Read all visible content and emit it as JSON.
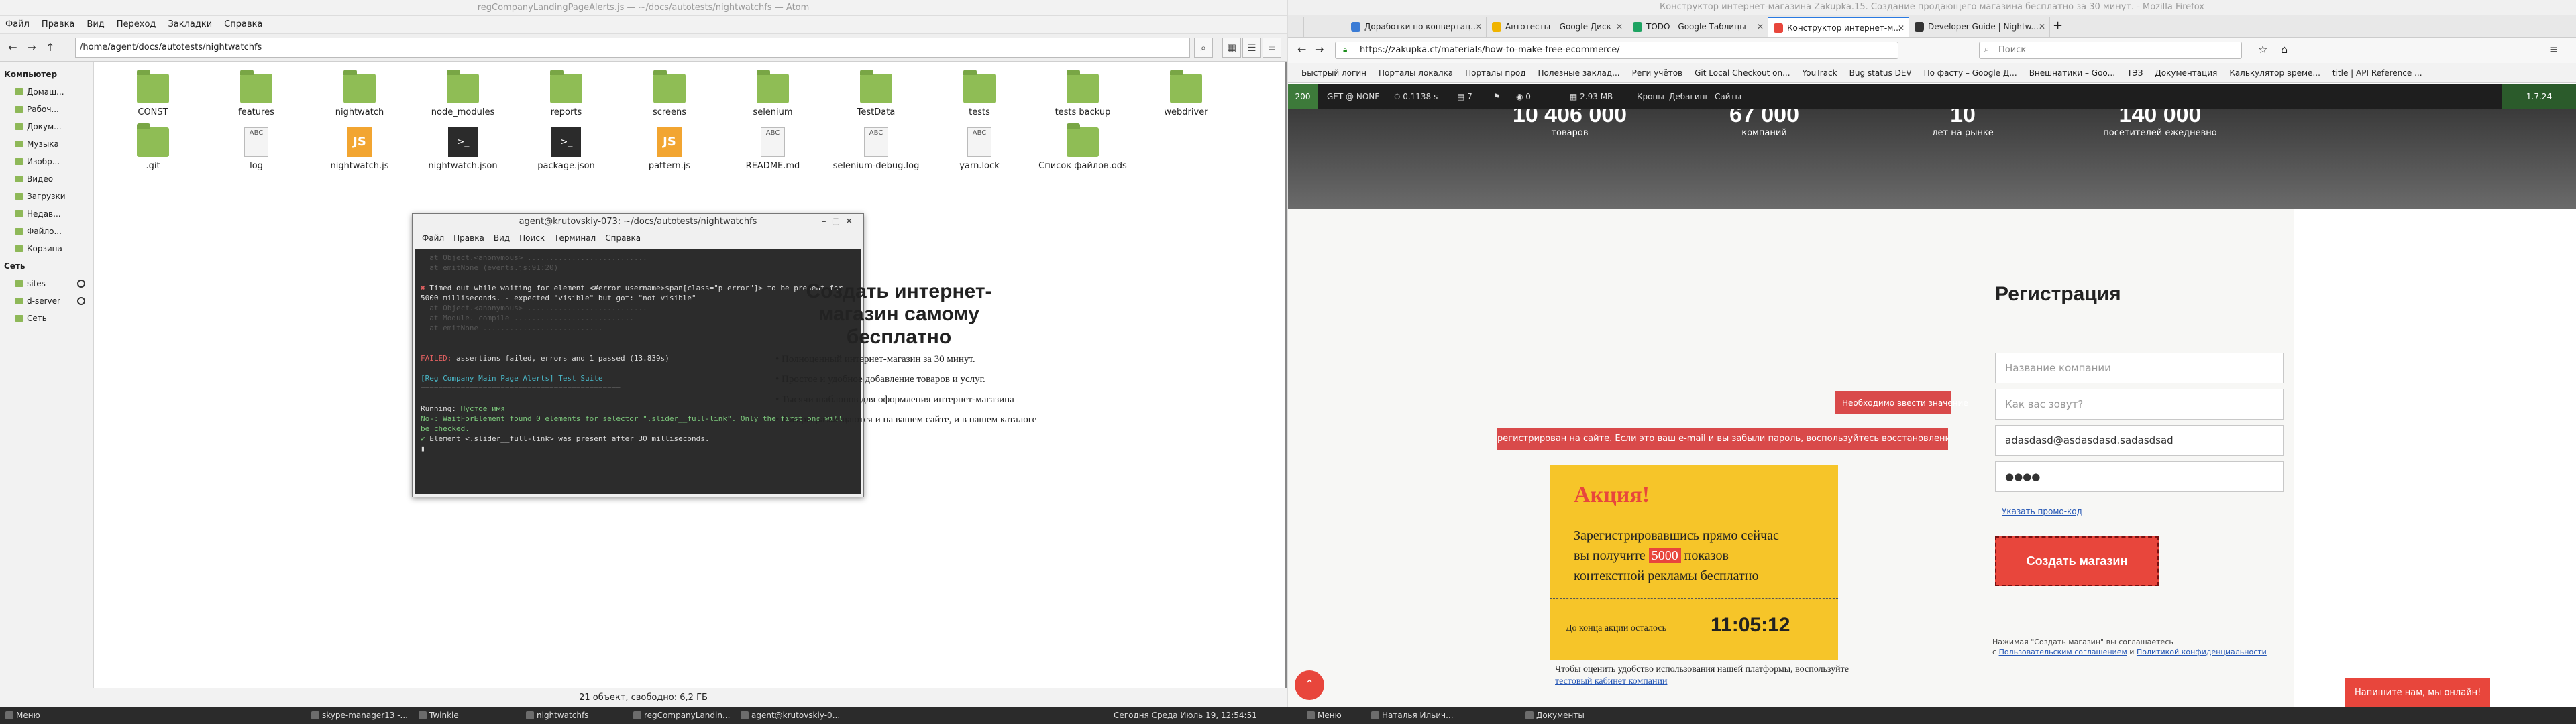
{
  "file_manager": {
    "title": "regCompanyLandingPageAlerts.js — ~/docs/autotests/nightwatchfs — Atom",
    "menu": [
      "Файл",
      "Правка",
      "Вид",
      "Переход",
      "Закладки",
      "Справка"
    ],
    "path": "/home/agent/docs/autotests/nightwatchfs",
    "sidebar": {
      "computer_header": "Компьютер",
      "computer_items": [
        "Домаш...",
        "Рабоч...",
        "Докум...",
        "Музыка",
        "Изобр...",
        "Видео",
        "Загрузки",
        "Недав...",
        "Файло...",
        "Корзина"
      ],
      "network_header": "Сеть",
      "network_items": [
        "sites",
        "d-server",
        "Сеть"
      ]
    },
    "files": [
      {
        "name": "CONST",
        "type": "folder"
      },
      {
        "name": "features",
        "type": "folder"
      },
      {
        "name": "nightwatch",
        "type": "folder"
      },
      {
        "name": "node_modules",
        "type": "folder"
      },
      {
        "name": "reports",
        "type": "folder"
      },
      {
        "name": "screens",
        "type": "folder"
      },
      {
        "name": "selenium",
        "type": "folder"
      },
      {
        "name": "TestData",
        "type": "folder"
      },
      {
        "name": "tests",
        "type": "folder"
      },
      {
        "name": "tests backup",
        "type": "folder"
      },
      {
        "name": "webdriver",
        "type": "folder"
      },
      {
        "name": ".git",
        "type": "folder"
      },
      {
        "name": "log",
        "type": "doc"
      },
      {
        "name": "nightwatch.js",
        "type": "js"
      },
      {
        "name": "nightwatch.json",
        "type": "term"
      },
      {
        "name": "package.json",
        "type": "term"
      },
      {
        "name": "pattern.js",
        "type": "js"
      },
      {
        "name": "README.md",
        "type": "doc"
      },
      {
        "name": "selenium-debug.log",
        "type": "doc"
      },
      {
        "name": "yarn.lock",
        "type": "doc"
      },
      {
        "name": "Список файлов.ods",
        "type": "folder"
      }
    ],
    "status": "21 объект, свободно: 6,2 ГБ"
  },
  "terminal": {
    "title": "agent@krutovskiy-073: ~/docs/autotests/nightwatchfs",
    "menu": [
      "Файл",
      "Правка",
      "Вид",
      "Поиск",
      "Терминал",
      "Справка"
    ],
    "lines": {
      "timeout": "Timed out while waiting for element <#error_username>span[class=\"p_error\"]> to be present for 5000 milliseconds.  - expected \"visible\" but got: \"not visible\"",
      "summary_fail": "FAILED:",
      "summary": "assertions failed,   errors and 1 passed (13.839s)",
      "suite": "[Reg Company Main Page Alerts] Test Suite",
      "running": "Running:",
      "running_name": "Пустое имя",
      "wait": "  No-: WaitForElement found 0 elements for selector \".slider__full-link\". Only the first one will be checked.",
      "present": "  Element <.slider__full-link> was present after 30 milliseconds."
    }
  },
  "browser": {
    "title": "Конструктор интернет-магазина Zakupka.15. Создание продающего магазина бесплатно за 30 минут. - Mozilla Firefox",
    "tabs": [
      "Доработки по конвертац...",
      "Автотесты – Google Диск",
      "TODO - Google Таблицы",
      "Конструктор интернет-м...",
      "Developer Guide | Nightw..."
    ],
    "url": "https://zakupka.ct/materials/how-to-make-free-ecommerce/",
    "search_placeholder": "Поиск",
    "bookmarks": [
      "Быстрый логин",
      "Порталы локалка",
      "Порталы прод",
      "Полезные заклад...",
      "Реги учётов",
      "Git Local Checkout on...",
      "YouTrack",
      "Bug status DEV",
      "По фасту – Google Д...",
      "Внешнатики – Goo...",
      "ТЭЗ",
      "Документация",
      "Калькулятор време...",
      "title | API Reference ..."
    ],
    "debug": {
      "code": "200",
      "method": "GET @ NONE",
      "time": "0.1138 s",
      "queries": "7",
      "mem": "2.93 MB",
      "items": [
        "Кроны",
        "Дебагинг",
        "Сайты"
      ],
      "version": "1.7.24"
    },
    "stats": [
      {
        "n": "10 406 000",
        "l": "товаров"
      },
      {
        "n": "67 000",
        "l": "компаний"
      },
      {
        "n": "10",
        "l": "лет на рынке"
      },
      {
        "n": "140 000",
        "l": "посетителей ежедневно"
      }
    ],
    "heading": "Создать интернет-магазин самому бесплатно",
    "features": [
      "• Полноценный интернет-магазин за 30 минут.",
      "• Простое и удобное добавление товаров и услуг.",
      "• Тысячи шаблонов для оформления интернет-магазина",
      "• Товары размещаются и на вашем сайте, и в нашем каталоге"
    ],
    "promo": {
      "title": "Акция!",
      "text1": "Зарегистрировавшись прямо сейчас",
      "text2a": "вы получите ",
      "badge": "5000",
      "text2b": " показов",
      "text3": "контекстной рекламы бесплатно",
      "countdown_label": "До конца акции осталось",
      "countdown": "11:05:12"
    },
    "below_promo": "Чтобы оценить удобство использования нашей платформы, воспользуйте",
    "below_promo_link": "тестовый кабинет компании",
    "registration": {
      "title": "Регистрация",
      "company_placeholder": "Название компании",
      "name_placeholder": "Как вас зовут?",
      "email_value": "adasdasd@asdasdasd.sadasdsad",
      "password_value": "●●●●",
      "error_tip": "Необходимо ввести значение",
      "error_bar": "регистрирован на сайте. Если это ваш e-mail и вы забыли пароль, воспользуйтесь",
      "error_bar_link": "восстановлением пароля.",
      "promo_link": "Указать промо-код",
      "button": "Создать магазин",
      "terms1": "Нажимая \"Создать магазин\" вы соглашаетесь",
      "terms2": "с",
      "terms_link1": "Пользовательским соглашением",
      "terms_and": "и",
      "terms_link2": "Политикой конфиденциальности"
    },
    "chat": "Напишите нам, мы онлайн!"
  },
  "taskbar": {
    "menu": "Меню",
    "tasks": [
      "skype-manager13 -...",
      "Twinkle",
      "nightwatchfs",
      "regCompanyLandin...",
      "agent@krutovskiy-0..."
    ],
    "clock": "Сегодня Среда Июль 19, 12:54:51",
    "menu2": "Меню",
    "tasks2": [
      "Наталья Ильич...",
      "Документы"
    ]
  }
}
